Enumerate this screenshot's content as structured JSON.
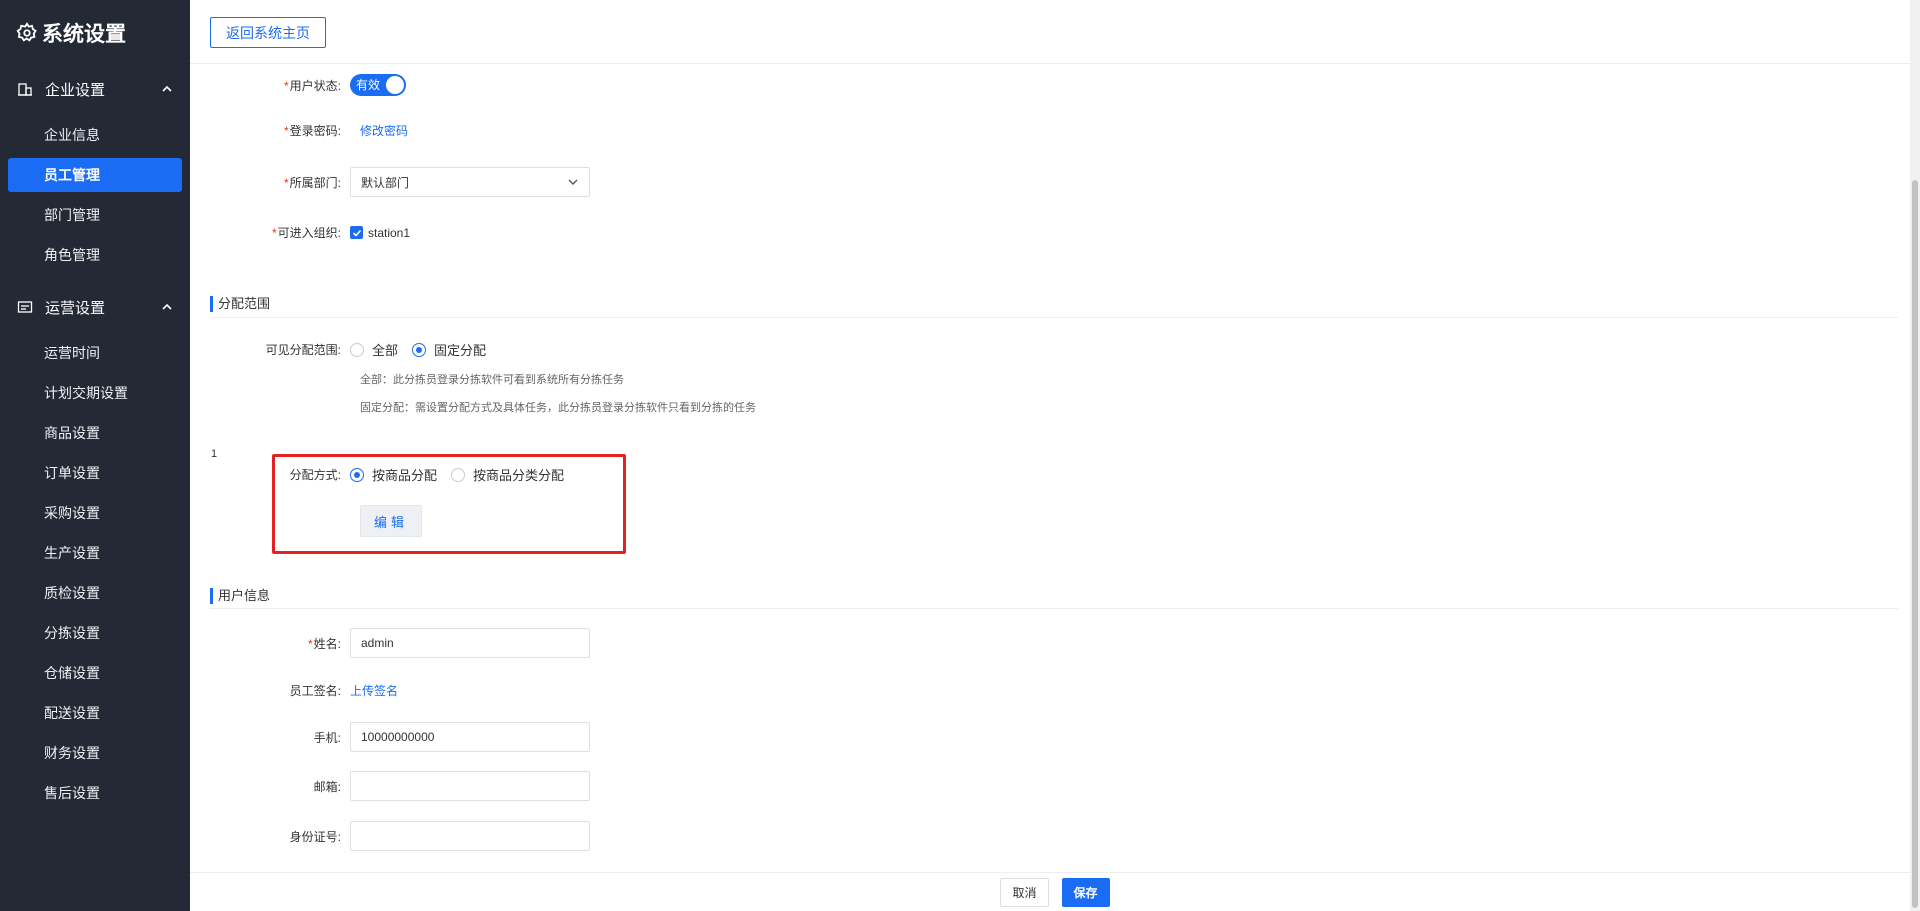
{
  "sidebar": {
    "title": "系统设置",
    "groups": [
      {
        "label": "企业设置",
        "items": [
          "企业信息",
          "员工管理",
          "部门管理",
          "角色管理"
        ]
      },
      {
        "label": "运营设置",
        "items": [
          "运营时间",
          "计划交期设置",
          "商品设置",
          "订单设置",
          "采购设置",
          "生产设置",
          "质检设置",
          "分拣设置",
          "仓储设置",
          "配送设置",
          "财务设置",
          "售后设置"
        ]
      }
    ],
    "active_item": "员工管理"
  },
  "topbar": {
    "back_label": "返回系统主页"
  },
  "form": {
    "user_status": {
      "label": "用户状态:",
      "value": "有效"
    },
    "password": {
      "label": "登录密码:",
      "link": "修改密码"
    },
    "department": {
      "label": "所属部门:",
      "value": "默认部门"
    },
    "org": {
      "label": "可进入组织:",
      "value": "station1"
    }
  },
  "assign_section": {
    "title": "分配范围",
    "scope_label": "可见分配范围:",
    "scope_options": [
      "全部",
      "固定分配"
    ],
    "scope_selected": "固定分配",
    "help_all": "全部：此分拣员登录分拣软件可看到系统所有分拣任务",
    "help_fixed": "固定分配：需设置分配方式及具体任务，此分拣员登录分拣软件只看到分拣的任务",
    "marker": "1",
    "method_label": "分配方式:",
    "method_options": [
      "按商品分配",
      "按商品分类分配"
    ],
    "method_selected": "按商品分配",
    "edit_label": "编辑"
  },
  "user_section": {
    "title": "用户信息",
    "name_label": "姓名:",
    "name_value": "admin",
    "signature_label": "员工签名:",
    "signature_link": "上传签名",
    "phone_label": "手机:",
    "phone_value": "10000000000",
    "email_label": "邮箱:",
    "email_value": "",
    "id_label": "身份证号:",
    "id_value": ""
  },
  "footer": {
    "cancel_label": "取消",
    "save_label": "保存"
  },
  "colors": {
    "primary": "#1a6cf5",
    "sidebar_bg": "#232a35",
    "highlight": "#e62121",
    "required": "#e5331b"
  }
}
